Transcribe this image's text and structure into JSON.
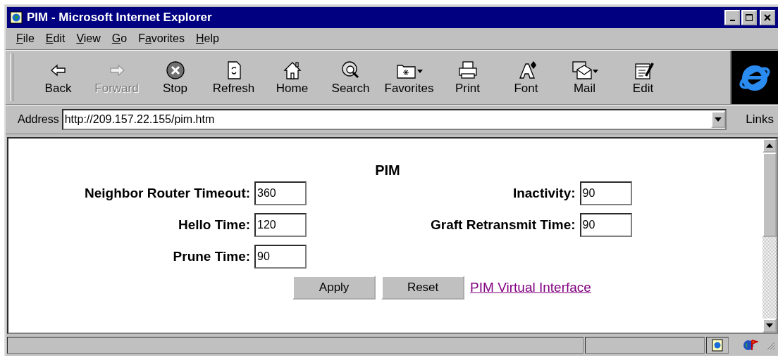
{
  "window": {
    "title": "PIM - Microsoft Internet Explorer"
  },
  "menu": [
    {
      "label": "File"
    },
    {
      "label": "Edit"
    },
    {
      "label": "View"
    },
    {
      "label": "Go"
    },
    {
      "label": "Favorites"
    },
    {
      "label": "Help"
    }
  ],
  "toolbar": [
    {
      "label": "Back",
      "disabled": false,
      "has_menu": false
    },
    {
      "label": "Forward",
      "disabled": true,
      "has_menu": false
    },
    {
      "label": "Stop",
      "disabled": false,
      "has_menu": false
    },
    {
      "label": "Refresh",
      "disabled": false,
      "has_menu": false
    },
    {
      "label": "Home",
      "disabled": false,
      "has_menu": false
    },
    {
      "label": "Search",
      "disabled": false,
      "has_menu": false
    },
    {
      "label": "Favorites",
      "disabled": false,
      "has_menu": true
    },
    {
      "label": "Print",
      "disabled": false,
      "has_menu": false
    },
    {
      "label": "Font",
      "disabled": false,
      "has_menu": false
    },
    {
      "label": "Mail",
      "disabled": false,
      "has_menu": true
    },
    {
      "label": "Edit",
      "disabled": false,
      "has_menu": false
    }
  ],
  "address_bar": {
    "label": "Address",
    "value": "http://209.157.22.155/pim.htm",
    "links": "Links"
  },
  "page": {
    "title": "PIM",
    "left_fields": [
      {
        "label": "Neighbor Router Timeout:",
        "value": "360"
      },
      {
        "label": "Hello Time:",
        "value": "120"
      },
      {
        "label": "Prune Time:",
        "value": "90"
      }
    ],
    "right_fields": [
      {
        "label": "Inactivity:",
        "value": "90"
      },
      {
        "label": "Graft Retransmit Time:",
        "value": "90"
      }
    ],
    "buttons": [
      "Apply",
      "Reset"
    ],
    "link": "PIM Virtual Interface"
  }
}
